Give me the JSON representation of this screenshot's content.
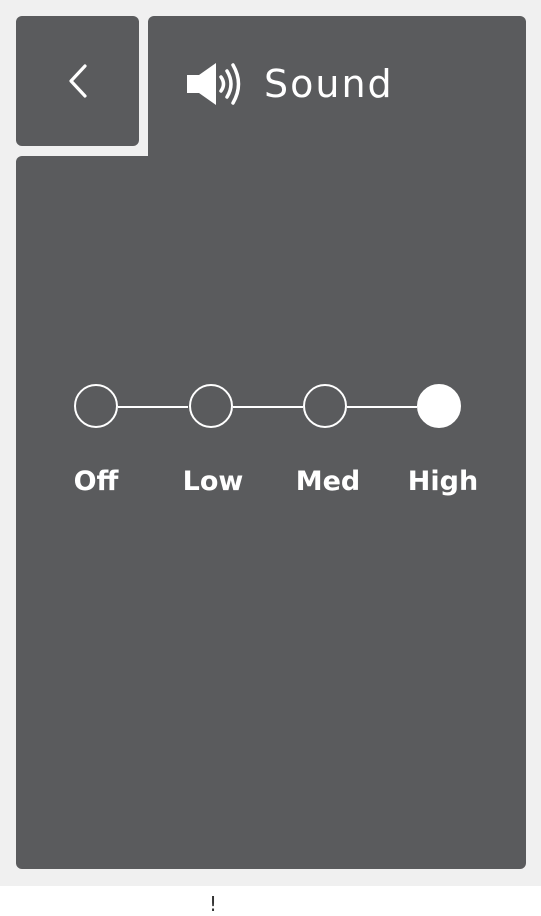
{
  "header": {
    "title": "Sound",
    "back_icon": "chevron-left-icon",
    "title_icon": "speaker-icon"
  },
  "sound_level": {
    "options": [
      "Off",
      "Low",
      "Med",
      "High"
    ],
    "selected": "High",
    "selected_index": 3
  },
  "footer": {
    "caret_text": "!"
  },
  "colors": {
    "frame": "#f0f0f0",
    "panel": "#5a5b5d",
    "foreground": "#ffffff"
  }
}
